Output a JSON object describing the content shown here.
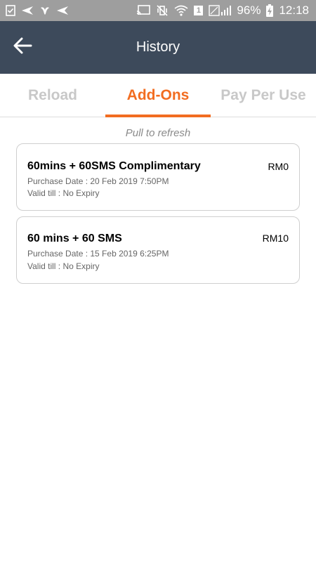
{
  "status_bar": {
    "battery": "96%",
    "time": "12:18",
    "left_icons": [
      "checkbox-notification-icon",
      "send-icon",
      "bird-icon",
      "send-icon"
    ],
    "right_icons": [
      "cast-icon",
      "vibrate-off-icon",
      "wifi-icon",
      "sim-badge-icon",
      "signal-icon",
      "battery-charging-icon"
    ],
    "sim_badge": "1"
  },
  "app_bar": {
    "title": "History",
    "back_icon": "arrow-left-icon",
    "background": "#3d4a5b"
  },
  "tabs": [
    {
      "label": "Reload",
      "active": false
    },
    {
      "label": "Add-Ons",
      "active": true
    },
    {
      "label": "Pay Per Use",
      "active": false
    }
  ],
  "accent_color": "#f26d21",
  "pull_hint": "Pull to refresh",
  "purchases": [
    {
      "name": "60mins + 60SMS Complimentary",
      "price": "RM0",
      "purchase_date": "Purchase Date : 20 Feb 2019 7:50PM",
      "valid_till": "Valid till : No Expiry"
    },
    {
      "name": "60 mins + 60 SMS",
      "price": "RM10",
      "purchase_date": "Purchase Date : 15 Feb 2019 6:25PM",
      "valid_till": "Valid till : No Expiry"
    }
  ]
}
